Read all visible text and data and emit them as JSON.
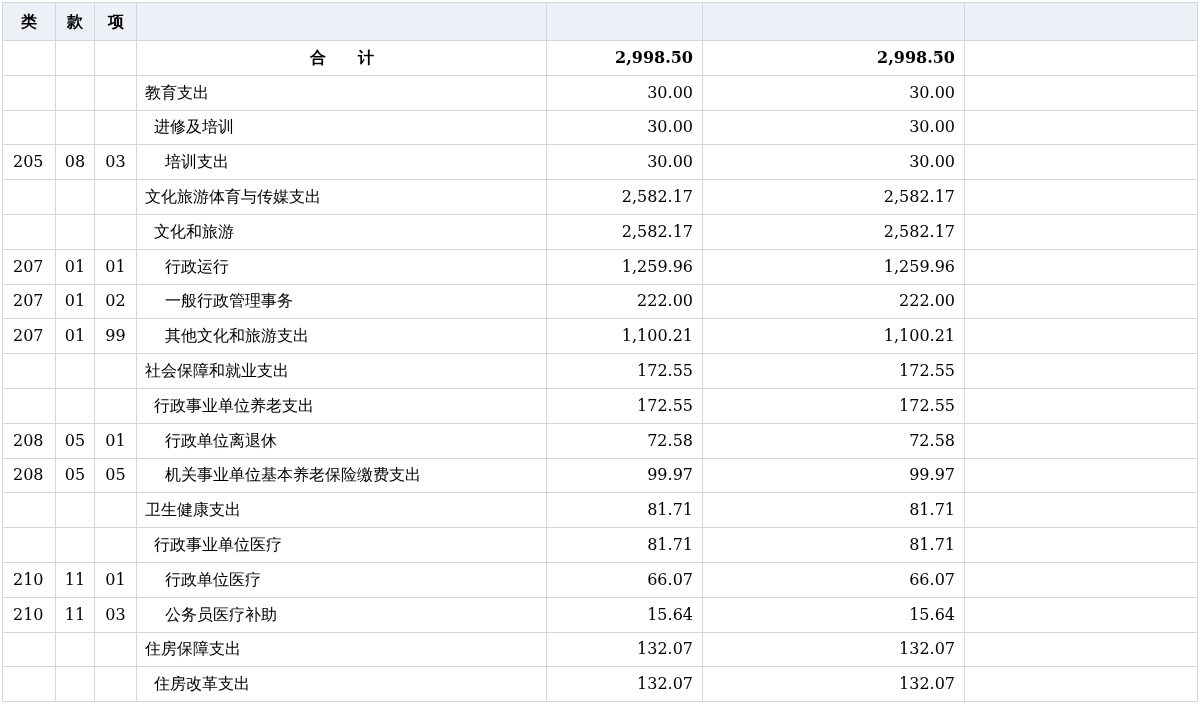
{
  "table": {
    "columns": [
      "类",
      "款",
      "项"
    ],
    "total": {
      "name": "合　　计",
      "column_5": "2,998.50",
      "column_6": "2,998.50"
    },
    "rows": [
      {
        "name": "教育支出",
        "column_5": "30.00",
        "column_6": "30.00",
        "children": [
          {
            "name": "进修及培训",
            "column_5": "30.00",
            "column_6": "30.00",
            "children": [
              {
                "lei": "205",
                "kuan": "08",
                "xiang": "03",
                "name": "培训支出",
                "column_5": "30.00",
                "column_6": "30.00"
              }
            ]
          }
        ]
      },
      {
        "name": "文化旅游体育与传媒支出",
        "column_5": "2,582.17",
        "column_6": "2,582.17",
        "children": [
          {
            "name": "文化和旅游",
            "column_5": "2,582.17",
            "column_6": "2,582.17",
            "children": [
              {
                "lei": "207",
                "kuan": "01",
                "xiang": "01",
                "name": "行政运行",
                "column_5": "1,259.96",
                "column_6": "1,259.96"
              },
              {
                "lei": "207",
                "kuan": "01",
                "xiang": "02",
                "name": "一般行政管理事务",
                "column_5": "222.00",
                "column_6": "222.00"
              },
              {
                "lei": "207",
                "kuan": "01",
                "xiang": "99",
                "name": "其他文化和旅游支出",
                "column_5": "1,100.21",
                "column_6": "1,100.21"
              }
            ]
          }
        ]
      },
      {
        "name": "社会保障和就业支出",
        "column_5": "172.55",
        "column_6": "172.55",
        "children": [
          {
            "name": "行政事业单位养老支出",
            "column_5": "172.55",
            "column_6": "172.55",
            "children": [
              {
                "lei": "208",
                "kuan": "05",
                "xiang": "01",
                "name": "行政单位离退休",
                "column_5": "72.58",
                "column_6": "72.58"
              },
              {
                "lei": "208",
                "kuan": "05",
                "xiang": "05",
                "name": "机关事业单位基本养老保险缴费支出",
                "column_5": "99.97",
                "column_6": "99.97"
              }
            ]
          }
        ]
      },
      {
        "name": "卫生健康支出",
        "column_5": "81.71",
        "column_6": "81.71",
        "children": [
          {
            "name": "行政事业单位医疗",
            "column_5": "81.71",
            "column_6": "81.71",
            "children": [
              {
                "lei": "210",
                "kuan": "11",
                "xiang": "01",
                "name": "行政单位医疗",
                "column_5": "66.07",
                "column_6": "66.07"
              },
              {
                "lei": "210",
                "kuan": "11",
                "xiang": "03",
                "name": "公务员医疗补助",
                "column_5": "15.64",
                "column_6": "15.64"
              }
            ]
          }
        ]
      },
      {
        "name": "住房保障支出",
        "column_5": "132.07",
        "column_6": "132.07",
        "children": [
          {
            "name": "住房改革支出",
            "column_5": "132.07",
            "column_6": "132.07"
          }
        ]
      }
    ]
  }
}
